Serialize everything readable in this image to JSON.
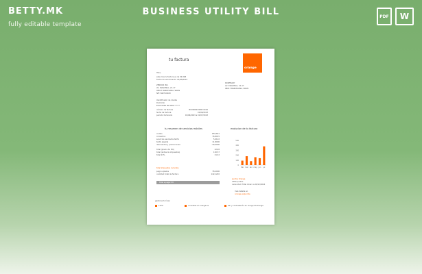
{
  "brand": {
    "logo": "BETTY.MK",
    "tagline": "fully editable template"
  },
  "title": "BUSINESS UTILITY BILL",
  "downloads": [
    {
      "label": "PDF",
      "icon": "pdf-file-icon"
    },
    {
      "label": "W",
      "icon": "word-file-icon"
    }
  ],
  "document": {
    "heading": "tu factura",
    "logo_text": "orange",
    "greeting": "Hola,",
    "intro": [
      "este mes tu factura es de 99,32€",
      "Fecha de vencimiento: 01/08/2023"
    ],
    "company": [
      "ZENDOR INC.",
      "AV. DIAGONAL, 21-17",
      "08017 BARCELONA, SPAIN",
      "NIF: B42710043"
    ],
    "client": [
      "ROSEMARY",
      "AV. DIAGONAL, 21-17",
      "08017 BARCELONA, SPAIN"
    ],
    "account": [
      "Identificador de cliente",
      "Domicilio",
      "ES12 0000 00 0000 ******"
    ],
    "invoice_info": [
      [
        "número de factura",
        "BU0000023082 0016"
      ],
      [
        "fecha de factura",
        "01/06/2023"
      ],
      [
        "periodo facturado",
        "01/06/2023 a 01/07/2023"
      ]
    ],
    "summary_title": "tu resumen de servicios móviles",
    "summary_rows": [
      [
        "cuotas",
        "€50,821"
      ],
      [
        "consumos",
        "76,8015"
      ],
      [
        "servicios asociados tarifa",
        "5,0122"
      ],
      [
        "tarifa elegida",
        "11,8000"
      ],
      [
        "descuentos y promociones",
        "-30,0000"
      ],
      [
        "total (previo de IVA)",
        "22,98"
      ],
      [
        "total (antes de impuestos)",
        "120,57"
      ],
      [
        "total 21%",
        "21,32"
      ]
    ],
    "taxes_title": "total impuestos incluidos",
    "tax_rows": [
      [
        "pago a plazos",
        "78,2000"
      ],
      [
        "cantidad total de factura",
        "142,1220"
      ]
    ],
    "bar_label": "total a pagar 99",
    "evolution_title": "evolucion de tu factura",
    "chart_axis": [
      "500",
      "400",
      "300",
      "200",
      "100",
      "0"
    ],
    "points_title": "puntos Orange",
    "points_lines": [
      "4782 puntos",
      "caducidad: Total dinero a 20/12/2024"
    ],
    "points_link": [
      "más detalle en",
      "orange.es/puntos"
    ],
    "footer_title": "gestiona tu línea",
    "footer_items": [
      "1470",
      "consultas en orange.es",
      "bar y contratación en mi app Mi Orange"
    ]
  },
  "chart_data": {
    "type": "bar",
    "title": "evolucion de tu factura",
    "categories": [
      "feb",
      "mar",
      "abr",
      "may",
      "jun",
      "jul"
    ],
    "values": [
      90,
      180,
      80,
      160,
      140,
      380
    ],
    "ylim": [
      0,
      500
    ],
    "colors": {
      "bars": "#ff6600"
    }
  }
}
